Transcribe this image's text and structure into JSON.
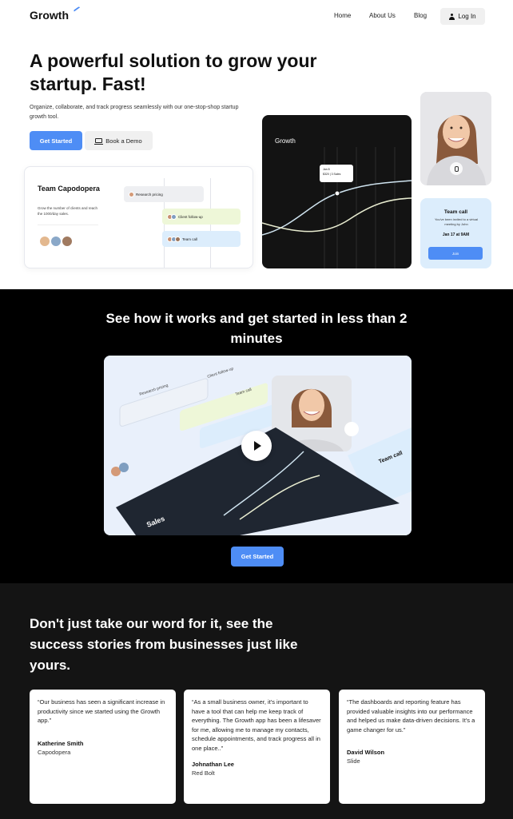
{
  "nav": {
    "logo": "Growth",
    "links": [
      "Home",
      "About Us",
      "Blog"
    ],
    "login": "Log In"
  },
  "hero": {
    "title": "A powerful solution to grow your startup. Fast!",
    "subtitle": "Organize, collaborate, and track progress seamlessly with our one-stop-shop startup growth tool.",
    "primary_cta": "Get Started",
    "secondary_cta": "Book a Demo"
  },
  "team_card": {
    "title": "Team Capodopera",
    "description": "Grow the number of clients and reach the 1000/day sales.",
    "tasks": [
      "Research pricing",
      "Client follow-up",
      "Team call"
    ]
  },
  "growth_card": {
    "title": "Growth",
    "tooltip_date": "Jan 8",
    "tooltip_value": "$320 | 3 Sales"
  },
  "call_card": {
    "title": "Team call",
    "description": "You've been invited to a virtual meeting by John",
    "date": "Jan 17 at 9AM",
    "join": "Join"
  },
  "section_video": {
    "title": "See how it works and get started in less than 2 minutes",
    "cta": "Get Started",
    "video_labels": {
      "research": "Research pricing",
      "client": "Client follow-up",
      "team": "Team call",
      "call": "Team call",
      "sales": "Sales"
    }
  },
  "testimonials": {
    "title": "Don't just take our word for it, see the success stories from businesses just like yours.",
    "items": [
      {
        "quote": "“Our business has seen a significant increase in productivity since we started using the Growth app.”",
        "name": "Katherine Smith",
        "company": "Capodopera"
      },
      {
        "quote": "“As a small business owner, it's important to have a tool that can help me keep track of everything. The Growth app has been a lifesaver for me, allowing me to manage my contacts, schedule appointments, and track progress all in one place..”",
        "name": "Johnathan Lee",
        "company": "Red Bolt"
      },
      {
        "quote": "“The dashboards and reporting feature has provided valuable insights into our performance and helped us make data-driven decisions. It's a game changer for us.”",
        "name": "David Wilson",
        "company": "Slide"
      }
    ]
  }
}
